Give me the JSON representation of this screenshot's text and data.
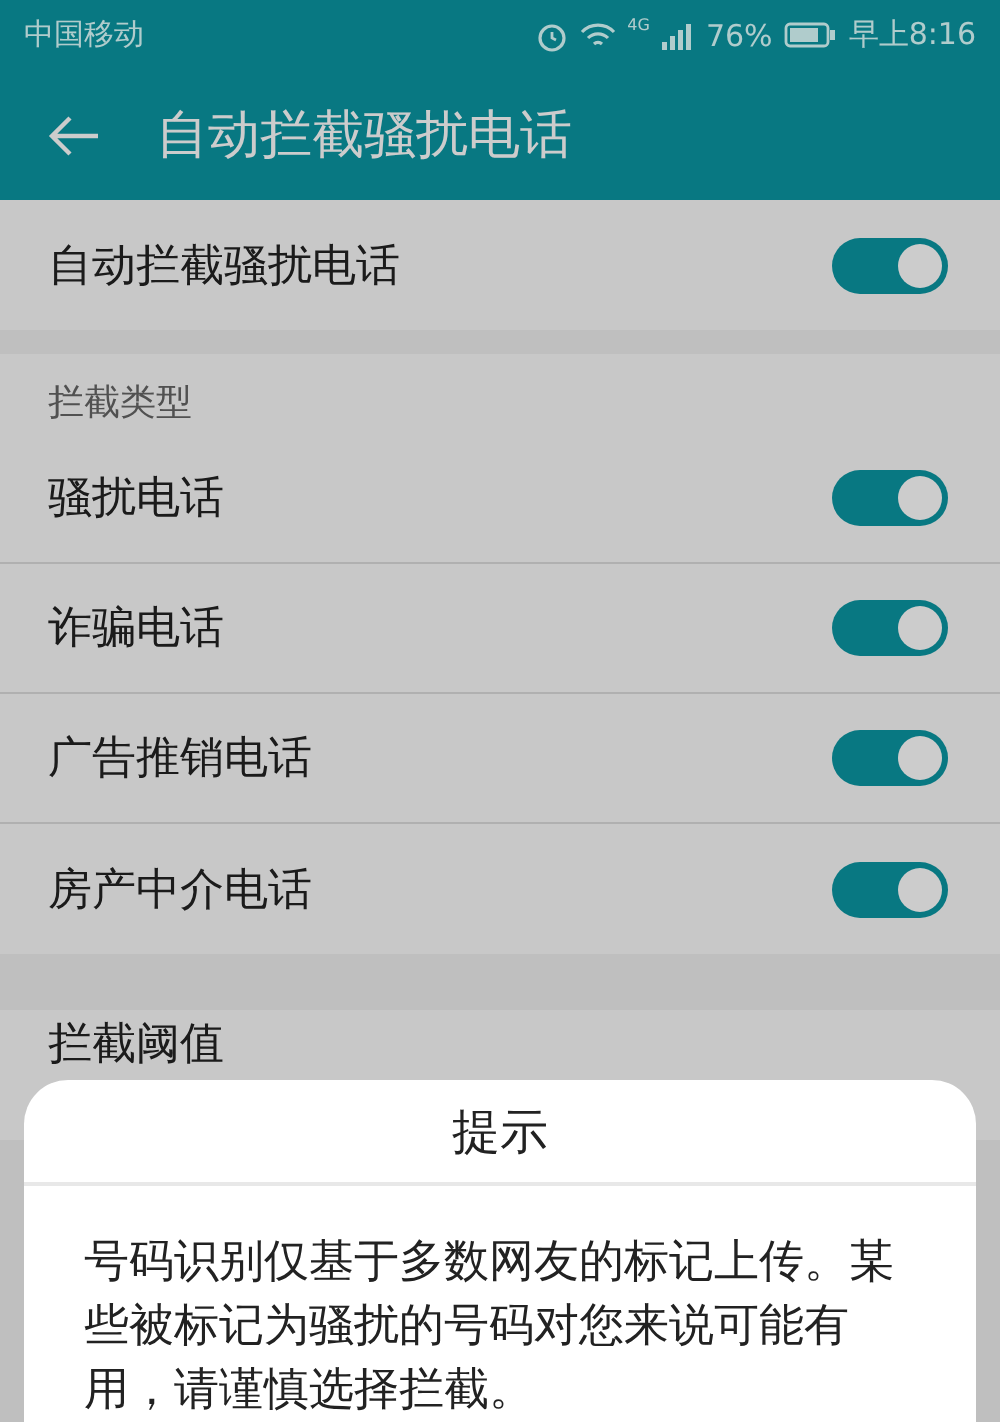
{
  "status_bar": {
    "carrier": "中国移动",
    "network": "4G",
    "battery": "76%",
    "time": "早上8:16"
  },
  "header": {
    "title": "自动拦截骚扰电话"
  },
  "master": {
    "label": "自动拦截骚扰电话",
    "on": true
  },
  "section": {
    "title": "拦截类型",
    "items": [
      {
        "label": "骚扰电话",
        "on": true
      },
      {
        "label": "诈骗电话",
        "on": true
      },
      {
        "label": "广告推销电话",
        "on": true
      },
      {
        "label": "房产中介电话",
        "on": true
      }
    ]
  },
  "threshold": {
    "label": "拦截阈值"
  },
  "dialog": {
    "title": "提示",
    "message": "号码识别仅基于多数网友的标记上传。某些被标记为骚扰的号码对您来说可能有用，请谨慎选择拦截。"
  }
}
